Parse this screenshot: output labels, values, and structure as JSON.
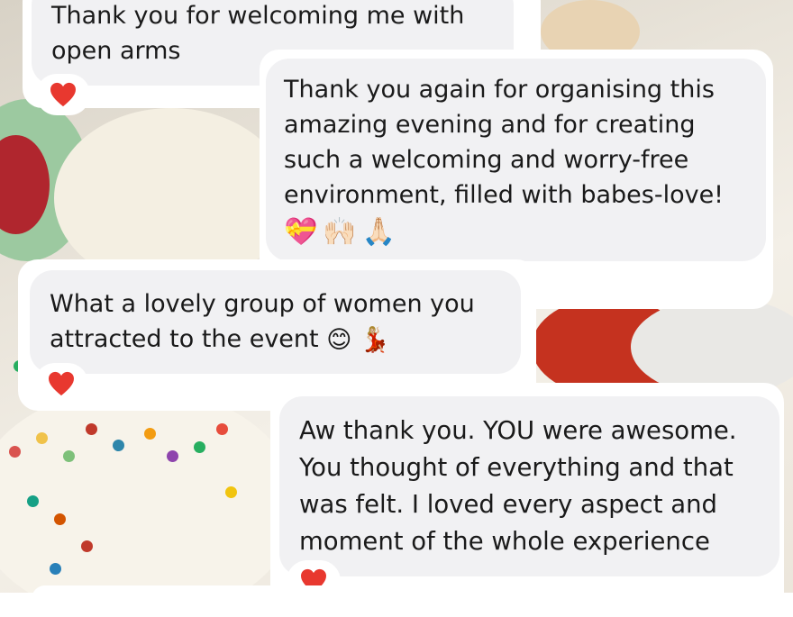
{
  "messages": [
    {
      "id": "m1",
      "side": "received",
      "lines": [
        "Thank you for welcoming me with",
        "open arms"
      ],
      "reaction": "heart-icon"
    },
    {
      "id": "m2",
      "side": "received",
      "lines": [
        "Thank you again for organising this",
        "amazing evening and for creating",
        "such a welcoming and worry-free",
        "environment, filled with babes-love!"
      ],
      "emojis": [
        "💝",
        "🙌🏻",
        "🙏🏻"
      ]
    },
    {
      "id": "m3",
      "side": "received",
      "lines": [
        "What a lovely group of women you",
        "attracted to the event"
      ],
      "trailing_emojis": [
        "😊",
        "💃🏼"
      ],
      "reaction": "heart-icon"
    },
    {
      "id": "m4",
      "side": "sent",
      "lines": [
        "Aw thank you. YOU were awesome.",
        "You thought of everything and that",
        "was felt. I loved every aspect and",
        "moment of the whole experience"
      ],
      "reaction": "heart-icon"
    }
  ],
  "colors": {
    "bubble": "#f1f1f3",
    "card": "#ffffff",
    "heart": "#e8382f",
    "text": "#1a1a1a"
  }
}
